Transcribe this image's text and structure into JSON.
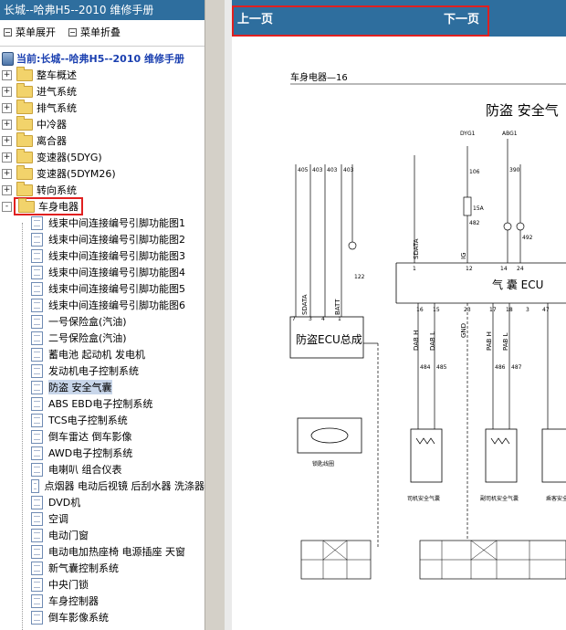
{
  "app": {
    "title": "长城--哈弗H5--2010 维修手册"
  },
  "menu": {
    "expand_label": "菜单展开",
    "collapse_label": "菜单折叠"
  },
  "current": {
    "label": "当前:长城--哈弗H5--2010 维修手册"
  },
  "tree": {
    "folders": [
      "整车概述",
      "进气系统",
      "排气系统",
      "中冷器",
      "离合器",
      "变速器(5DYG)",
      "变速器(5DYM26)",
      "转向系统"
    ],
    "open_folder": "车身电器",
    "children": [
      "线束中间连接编号引脚功能图1",
      "线束中间连接编号引脚功能图2",
      "线束中间连接编号引脚功能图3",
      "线束中间连接编号引脚功能图4",
      "线束中间连接编号引脚功能图5",
      "线束中间连接编号引脚功能图6",
      "一号保险盒(汽油)",
      "二号保险盒(汽油)",
      "蓄电池 起动机 发电机",
      "发动机电子控制系统",
      "防盗 安全气囊",
      "ABS EBD电子控制系统",
      "TCS电子控制系统",
      "倒车雷达 倒车影像",
      "AWD电子控制系统",
      "电喇叭 组合仪表",
      "点烟器 电动后视镜 后刮水器 洗涤器",
      "DVD机",
      "空调",
      "电动门窗",
      "电动电加热座椅 电源插座 天窗",
      "新气囊控制系统",
      "中央门锁",
      "车身控制器",
      "倒车影像系统"
    ],
    "selected_child": "防盗 安全气囊"
  },
  "nav": {
    "prev_label": "上一页",
    "next_label": "下一页"
  },
  "diagram": {
    "page_header": "车身电器—16",
    "title": "防盗 安全气",
    "immo_ecu_label": "防盗ECU总成",
    "airbag_ecu_label": "气  囊  ECU",
    "signals": {
      "sdata": "SDATA",
      "batt": "BATT",
      "ig": "IG",
      "gnd": "GND",
      "dab_h": "DAB H",
      "dab_l": "DAB L",
      "pab_h": "PAB H",
      "pab_l": "PAB L"
    },
    "top_labels": [
      "DYG1",
      "ABG1"
    ],
    "wire_codes": [
      "405",
      "403",
      "403",
      "403",
      "122",
      "484",
      "485",
      "486",
      "487",
      "106",
      "390",
      "492",
      "482"
    ],
    "pins_immo": [
      "7",
      "3",
      "4",
      "1"
    ],
    "pins_airbag_top": [
      "1",
      "12",
      "14",
      "24"
    ],
    "pins_airbag_bottom": [
      "16",
      "15",
      "23",
      "17",
      "18",
      "3",
      "47"
    ],
    "immo_coil_label": "锁匙线圈",
    "driver_airbag_label": "司机安全气囊",
    "passenger_airbag_label": "副司机安全气囊",
    "extra_airbag_label": "乘客安全气",
    "fuse_label": "15A",
    "colors": {
      "header_blue": "#2e6e9e",
      "highlight_red": "#e02020",
      "link_blue": "#1a3fb0"
    }
  }
}
